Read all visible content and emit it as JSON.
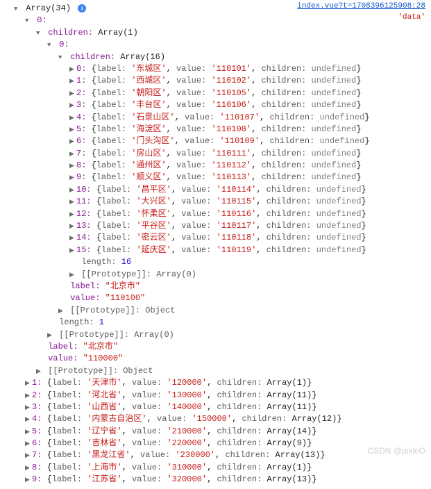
{
  "top_link": "index.vue?t=1708396125908:28",
  "top_tag": "'data'",
  "root_label": "Array(34)",
  "root_idx": "0:",
  "children_header": "children:",
  "children_type_outer": "Array(1)",
  "inner_idx": "0:",
  "children_type_inner": "Array(16)",
  "districts": [
    {
      "i": "0",
      "label": "'东城区'",
      "value": "'110101'",
      "children": "undefined"
    },
    {
      "i": "1",
      "label": "'西城区'",
      "value": "'110102'",
      "children": "undefined"
    },
    {
      "i": "2",
      "label": "'朝阳区'",
      "value": "'110105'",
      "children": "undefined"
    },
    {
      "i": "3",
      "label": "'丰台区'",
      "value": "'110106'",
      "children": "undefined"
    },
    {
      "i": "4",
      "label": "'石景山区'",
      "value": "'110107'",
      "children": "undefined"
    },
    {
      "i": "5",
      "label": "'海淀区'",
      "value": "'110108'",
      "children": "undefined"
    },
    {
      "i": "6",
      "label": "'门头沟区'",
      "value": "'110109'",
      "children": "undefined"
    },
    {
      "i": "7",
      "label": "'房山区'",
      "value": "'110111'",
      "children": "undefined"
    },
    {
      "i": "8",
      "label": "'通州区'",
      "value": "'110112'",
      "children": "undefined"
    },
    {
      "i": "9",
      "label": "'顺义区'",
      "value": "'110113'",
      "children": "undefined"
    },
    {
      "i": "10",
      "label": "'昌平区'",
      "value": "'110114'",
      "children": "undefined"
    },
    {
      "i": "11",
      "label": "'大兴区'",
      "value": "'110115'",
      "children": "undefined"
    },
    {
      "i": "12",
      "label": "'怀柔区'",
      "value": "'110116'",
      "children": "undefined"
    },
    {
      "i": "13",
      "label": "'平谷区'",
      "value": "'110117'",
      "children": "undefined"
    },
    {
      "i": "14",
      "label": "'密云区'",
      "value": "'110118'",
      "children": "undefined"
    },
    {
      "i": "15",
      "label": "'延庆区'",
      "value": "'110119'",
      "children": "undefined"
    }
  ],
  "length_inner_key": "length:",
  "length_inner_val": "16",
  "proto_label": "[[Prototype]]:",
  "proto_arr": "Array(0)",
  "proto_obj": "Object",
  "city_label_key": "label:",
  "city_label_val": "\"北京市\"",
  "city_value_key": "value:",
  "city_value_val": "\"110100\"",
  "length_outer_key": "length:",
  "length_outer_val": "1",
  "prov_label_val": "\"北京市\"",
  "prov_value_val": "\"110000\"",
  "provinces": [
    {
      "i": "1",
      "label": "'天津市'",
      "value": "'120000'",
      "children": "Array(1)"
    },
    {
      "i": "2",
      "label": "'河北省'",
      "value": "'130000'",
      "children": "Array(11)"
    },
    {
      "i": "3",
      "label": "'山西省'",
      "value": "'140000'",
      "children": "Array(11)"
    },
    {
      "i": "4",
      "label": "'内蒙古自治区'",
      "value": "'150000'",
      "children": "Array(12)"
    },
    {
      "i": "5",
      "label": "'辽宁省'",
      "value": "'210000'",
      "children": "Array(14)"
    },
    {
      "i": "6",
      "label": "'吉林省'",
      "value": "'220000'",
      "children": "Array(9)"
    },
    {
      "i": "7",
      "label": "'黑龙江省'",
      "value": "'230000'",
      "children": "Array(13)"
    },
    {
      "i": "8",
      "label": "'上海市'",
      "value": "'310000'",
      "children": "Array(1)"
    },
    {
      "i": "9",
      "label": "'江苏省'",
      "value": "'320000'",
      "children": "Array(13)"
    }
  ],
  "kw_label": "label:",
  "kw_value": "value:",
  "kw_children": "children:",
  "watermark": "CSDN @pixleO"
}
